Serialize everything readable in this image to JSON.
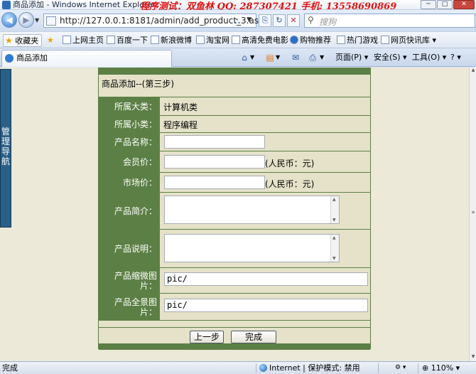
{
  "window": {
    "title": "商品添加 - Windows Internet Explorer",
    "overlay_text": "程序测试：双鱼林   QQ: 287307421   手机: 13558690869",
    "buttons": [
      "─",
      "□",
      "✕"
    ]
  },
  "address_bar": {
    "url": "http://127.0.0.1:8181/admin/add_product_3.asp",
    "search_placeholder": "搜狗"
  },
  "favorites_bar": {
    "favorites_label": "收藏夹",
    "links": [
      "上网主页",
      "百度一下",
      "新浪微博",
      "淘宝网",
      "高清免费电影",
      "购物推荐",
      "热门游戏",
      "网页快讯库 ▾"
    ]
  },
  "tab": {
    "label": "商品添加"
  },
  "command_bar": {
    "page_menu": "页面(P) ▾",
    "safety_menu": "安全(S) ▾",
    "tools_menu": "工具(O) ▾",
    "help_icon": "? ▾"
  },
  "side_nav": {
    "label": [
      "管",
      "理",
      "导",
      "航"
    ]
  },
  "form": {
    "title": "商品添加--(第三步)",
    "category_label": "所属大类：",
    "category_value": "计算机类",
    "subcategory_label": "所属小类：",
    "subcategory_value": "程序编程",
    "product_name_label": "产品名称：",
    "member_price_label": "会员价：",
    "member_price_unit": "(人民币：元)",
    "market_price_label": "市场价：",
    "market_price_unit": "(人民币：元)",
    "intro_label": "产品简介：",
    "description_label": "产品说明：",
    "thumb_label": "产品缩微图片：",
    "thumb_value": "pic/",
    "full_label": "产品全景图片：",
    "full_value": "pic/",
    "prev_button": "上一步",
    "finish_button": "完成"
  },
  "status_bar": {
    "status": "完成",
    "zone": "Internet | 保护模式: 禁用",
    "zoom": "110%"
  },
  "colors": {
    "label_bg": "#5c7f45",
    "form_bg": "#e5e2c9",
    "page_bg": "#ece9d8",
    "side_nav_bg": "#2a5f87",
    "overlay_text": "#e01313"
  }
}
